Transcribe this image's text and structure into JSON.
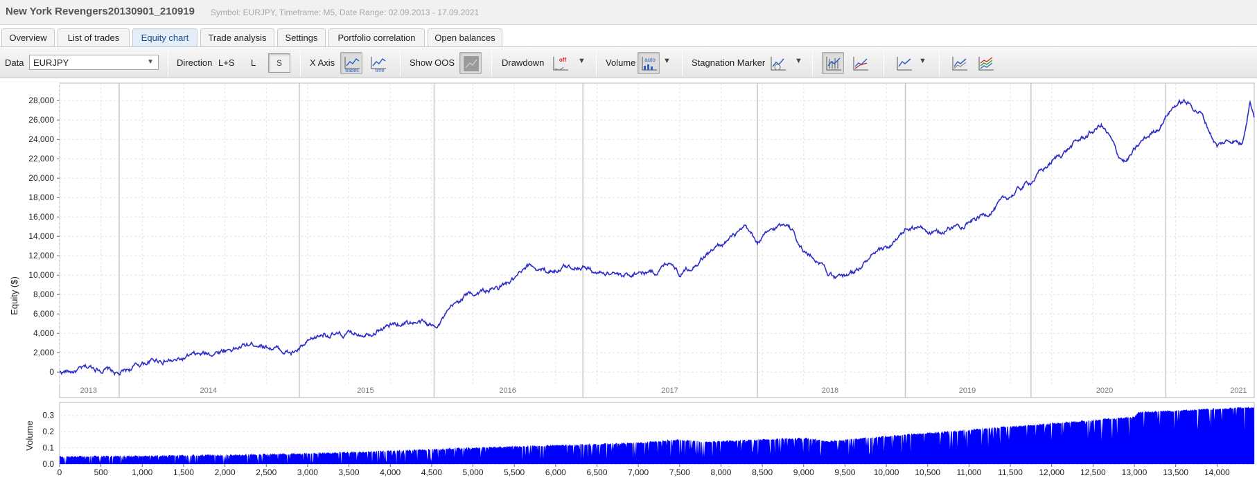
{
  "window": {
    "title": "New York Revengers20130901_210919",
    "subtitle": "Symbol: EURJPY, Timeframe: M5, Date Range: 02.09.2013 - 17.09.2021"
  },
  "tabs": [
    {
      "label": "Overview",
      "active": false
    },
    {
      "label": "List of trades",
      "active": false
    },
    {
      "label": "Equity chart",
      "active": true
    },
    {
      "label": "Trade analysis",
      "active": false
    },
    {
      "label": "Settings",
      "active": false
    },
    {
      "label": "Portfolio correlation",
      "active": false
    },
    {
      "label": "Open balances",
      "active": false
    }
  ],
  "toolbar": {
    "data_label": "Data",
    "data_value": "EURJPY",
    "direction_label": "Direction",
    "direction_ls": "L+S",
    "direction_l": "L",
    "direction_s": "S",
    "xaxis_label": "X Axis",
    "xaxis_trades_icon": "trades",
    "xaxis_time_icon": "time",
    "show_oos_label": "Show OOS",
    "drawdown_label": "Drawdown",
    "drawdown_icon_text": "off",
    "volume_label": "Volume",
    "volume_icon_text": "auto",
    "stagnation_label": "Stagnation Marker"
  },
  "colors": {
    "equity_line": "#2d2dc8",
    "volume_fill": "#0000ff",
    "grid": "#e2e2e2",
    "year_divider": "#c8c8c8",
    "tab_active_bg": "#e3eef8"
  },
  "chart_data": [
    {
      "type": "line",
      "ylabel": "Equity ($)",
      "ylim": [
        -1200,
        29800
      ],
      "yticks": [
        0,
        2000,
        4000,
        6000,
        8000,
        10000,
        12000,
        14000,
        16000,
        18000,
        20000,
        22000,
        24000,
        26000,
        28000
      ],
      "ytick_labels": [
        "0",
        "2,000",
        "4,000",
        "6,000",
        "8,000",
        "10,000",
        "12,000",
        "14,000",
        "16,000",
        "18,000",
        "20,000",
        "22,000",
        "24,000",
        "26,000",
        "28,000"
      ],
      "xlim": [
        0,
        14450
      ],
      "year_labels": [
        "2013",
        "2014",
        "2015",
        "2016",
        "2017",
        "2018",
        "2019",
        "2020",
        "2021"
      ],
      "year_label_x": [
        350,
        1800,
        3700,
        5420,
        7380,
        9320,
        10980,
        12640,
        14260
      ],
      "year_boundaries": [
        720,
        2900,
        4530,
        6330,
        8440,
        10230,
        11750,
        13380
      ],
      "grid": true,
      "series": [
        {
          "x": [
            0,
            200,
            400,
            600,
            720,
            850,
            1000,
            1200,
            1400,
            1600,
            1800,
            2000,
            2200,
            2400,
            2600,
            2800,
            2900,
            3000,
            3200,
            3400,
            3600,
            3800,
            4000,
            4200,
            4400,
            4530,
            4700,
            4900,
            5100,
            5300,
            5500,
            5700,
            5900,
            6100,
            6330,
            6500,
            6700,
            6800,
            7000,
            7200,
            7400,
            7500,
            7700,
            7900,
            8100,
            8300,
            8440,
            8600,
            8800,
            8900,
            9000,
            9200,
            9300,
            9400,
            9600,
            9800,
            10000,
            10200,
            10230,
            10400,
            10600,
            10800,
            11000,
            11200,
            11400,
            11600,
            11750,
            11900,
            12100,
            12300,
            12500,
            12600,
            12700,
            12800,
            12900,
            13100,
            13300,
            13400,
            13500,
            13600,
            13800,
            14000,
            14100,
            14200,
            14300,
            14400,
            14450
          ],
          "y": [
            0,
            100,
            500,
            200,
            -300,
            300,
            900,
            1300,
            1100,
            1600,
            1900,
            2300,
            2600,
            3000,
            2500,
            1900,
            2300,
            2900,
            4000,
            3700,
            4000,
            4300,
            4800,
            5200,
            5000,
            4700,
            6100,
            7900,
            8300,
            8600,
            9500,
            10900,
            10400,
            10800,
            11000,
            10200,
            10400,
            9700,
            10400,
            10300,
            11500,
            10200,
            11300,
            12600,
            13700,
            14700,
            13300,
            14500,
            15500,
            14200,
            12500,
            11400,
            10300,
            9500,
            10300,
            11700,
            12700,
            14100,
            14600,
            14900,
            14200,
            14900,
            15500,
            16300,
            17500,
            18800,
            19700,
            20900,
            22400,
            23700,
            24800,
            25500,
            24200,
            22400,
            21700,
            23800,
            25300,
            26700,
            27600,
            27900,
            26800,
            23300,
            23700,
            24000,
            23500,
            28100,
            26500
          ]
        }
      ]
    },
    {
      "type": "area",
      "ylabel": "Volume",
      "ylim": [
        0,
        0.38
      ],
      "yticks": [
        0,
        0.1,
        0.2,
        0.3
      ],
      "ytick_labels": [
        "0.0",
        "0.1",
        "0.2",
        "0.3"
      ],
      "xlim": [
        0,
        14450
      ],
      "xticks": [
        0,
        500,
        1000,
        1500,
        2000,
        2500,
        3000,
        3500,
        4000,
        4500,
        5000,
        5500,
        6000,
        6500,
        7000,
        7500,
        8000,
        8500,
        9000,
        9500,
        10000,
        10500,
        11000,
        11500,
        12000,
        12500,
        13000,
        13500,
        14000
      ],
      "xtick_labels": [
        "0",
        "500",
        "1,000",
        "1,500",
        "2,000",
        "2,500",
        "3,000",
        "3,500",
        "4,000",
        "4,500",
        "5,000",
        "5,500",
        "6,000",
        "6,500",
        "7,000",
        "7,500",
        "8,000",
        "8,500",
        "9,000",
        "9,500",
        "10,000",
        "10,500",
        "11,000",
        "11,500",
        "12,000",
        "12,500",
        "13,000",
        "13,500",
        "14,000"
      ],
      "grid": true,
      "series": [
        {
          "x": [
            0,
            1000,
            2000,
            3000,
            4000,
            5000,
            6000,
            7000,
            7500,
            7800,
            8000,
            9000,
            9300,
            9500,
            10000,
            11000,
            12000,
            13000,
            13050,
            14000,
            14450
          ],
          "y": [
            0.045,
            0.05,
            0.055,
            0.065,
            0.08,
            0.1,
            0.115,
            0.13,
            0.15,
            0.135,
            0.14,
            0.16,
            0.14,
            0.15,
            0.17,
            0.21,
            0.25,
            0.29,
            0.32,
            0.34,
            0.35
          ]
        }
      ]
    }
  ]
}
